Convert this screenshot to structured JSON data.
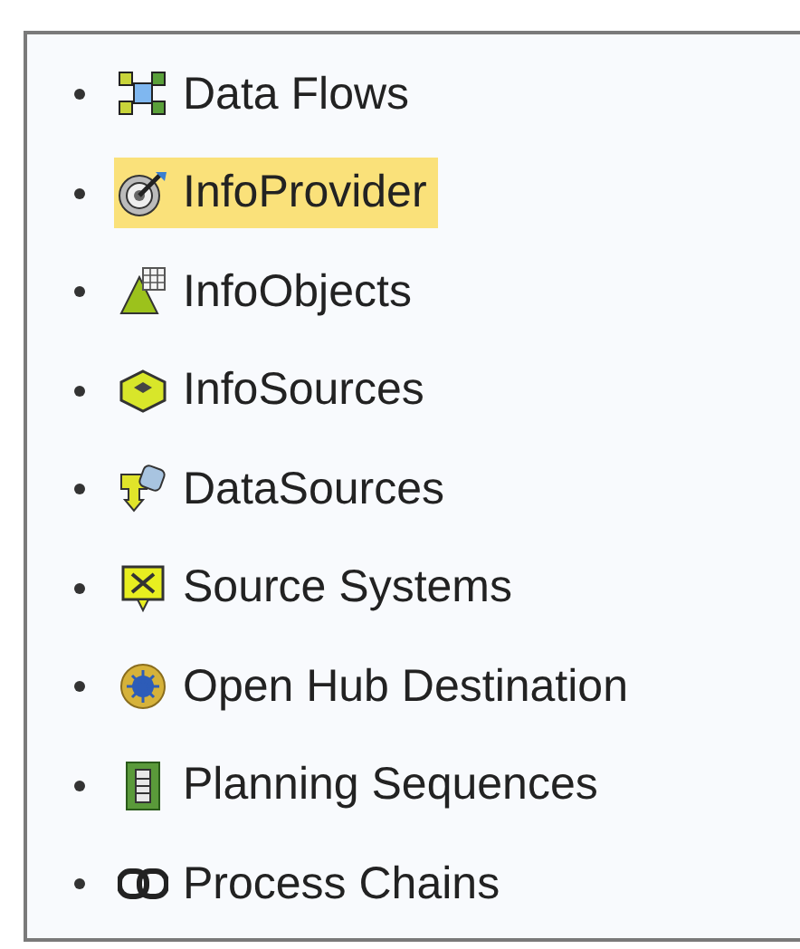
{
  "items": [
    {
      "label": "Data Flows",
      "selected": false
    },
    {
      "label": "InfoProvider",
      "selected": true
    },
    {
      "label": "InfoObjects",
      "selected": false
    },
    {
      "label": "InfoSources",
      "selected": false
    },
    {
      "label": "DataSources",
      "selected": false
    },
    {
      "label": "Source Systems",
      "selected": false
    },
    {
      "label": "Open Hub Destination",
      "selected": false
    },
    {
      "label": "Planning Sequences",
      "selected": false
    },
    {
      "label": "Process Chains",
      "selected": false
    }
  ]
}
